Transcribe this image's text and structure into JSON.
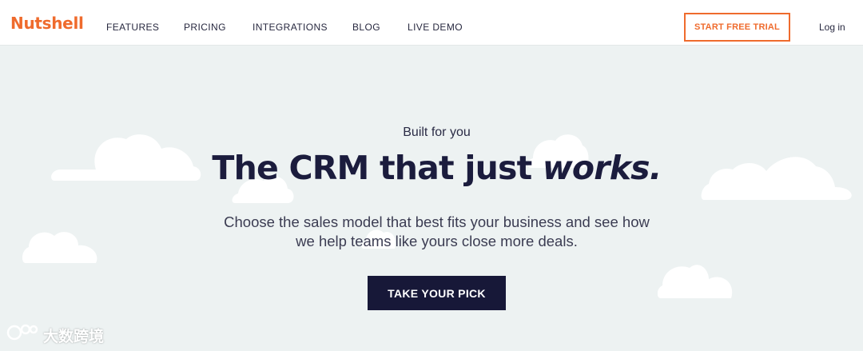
{
  "brand": {
    "logo_text": "Nutshell",
    "accent_color": "#ef6b2d"
  },
  "nav": {
    "links": [
      {
        "label": "FEATURES"
      },
      {
        "label": "PRICING"
      },
      {
        "label": "INTEGRATIONS"
      },
      {
        "label": "BLOG"
      },
      {
        "label": "LIVE DEMO"
      }
    ],
    "cta_label": "START FREE TRIAL",
    "login_label": "Log in"
  },
  "hero": {
    "eyebrow": "Built for you",
    "headline_prefix": "The CRM that just ",
    "headline_emphasis": "works.",
    "subtext_line1": "Choose the sales model that best fits your business and see how",
    "subtext_line2": "we help teams like yours close more deals.",
    "cta_label": "TAKE YOUR PICK",
    "cta_color": "#171838"
  },
  "watermark": {
    "text": "大数跨境"
  }
}
